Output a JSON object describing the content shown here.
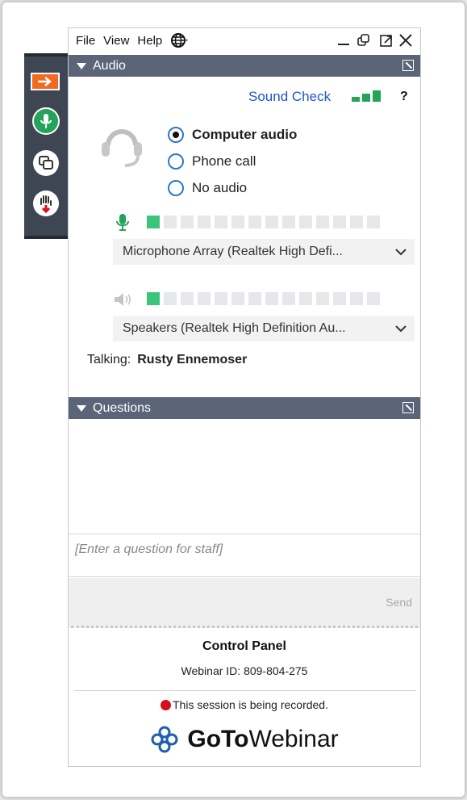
{
  "menu": {
    "file": "File",
    "view": "View",
    "help": "Help"
  },
  "sidebar": {
    "items": [
      {
        "icon": "orange-arrow-icon"
      },
      {
        "icon": "microphone-icon"
      },
      {
        "icon": "screen-share-icon"
      },
      {
        "icon": "raise-hand-icon"
      }
    ]
  },
  "audio": {
    "header": "Audio",
    "sound_check": "Sound Check",
    "help": "?",
    "options": [
      {
        "label": "Computer audio",
        "selected": true
      },
      {
        "label": "Phone call",
        "selected": false
      },
      {
        "label": "No audio",
        "selected": false
      }
    ],
    "mic_level": 1,
    "speaker_level": 1,
    "meter_cells": 14,
    "microphone": "Microphone Array (Realtek High Defi...",
    "speakers": "Speakers (Realtek High Definition Au...",
    "talking_label": "Talking:",
    "talking_name": "Rusty Ennemoser"
  },
  "questions": {
    "header": "Questions",
    "placeholder": "[Enter a question for staff]",
    "send": "Send"
  },
  "footer": {
    "title": "Control Panel",
    "webinar_id": "Webinar ID: 809-804-275",
    "recording": "This session is being recorded.",
    "brand_bold": "GoTo",
    "brand_rest": "Webinar"
  },
  "colors": {
    "accent": "#f26a21",
    "header": "#5b6577",
    "meter_on": "#3cc47a",
    "link": "#2255cc",
    "record": "#d40f1c"
  }
}
